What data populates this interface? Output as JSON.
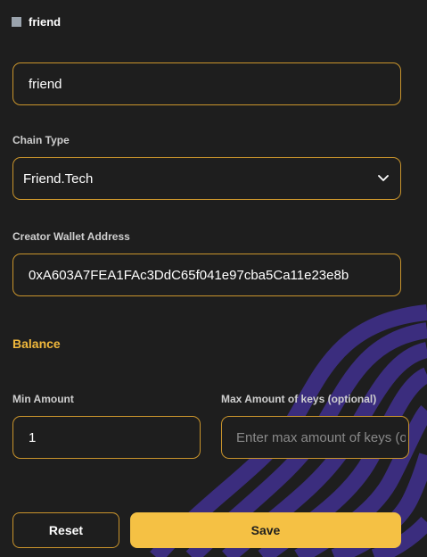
{
  "header": {
    "title": "friend"
  },
  "form": {
    "name_value": "friend",
    "chain_type_label": "Chain Type",
    "chain_type_value": "Friend.Tech",
    "creator_wallet_label": "Creator Wallet Address",
    "creator_wallet_value": "0xA603A7FEA1FAc3DdC65f041e97cba5Ca11e23e8b",
    "balance_title": "Balance",
    "min_amount_label": "Min Amount",
    "min_amount_value": "1",
    "max_amount_label": "Max Amount of keys (optional)",
    "max_amount_placeholder": "Enter max amount of keys (optional)"
  },
  "buttons": {
    "reset_label": "Reset",
    "save_label": "Save"
  },
  "colors": {
    "background": "#1e1e1e",
    "border_accent": "#c9942c",
    "balance_accent": "#f0b83c",
    "save_button": "#f5c144",
    "decor_purple": "#3b2d7e"
  },
  "icons": {
    "chain_dropdown": "chevron-down-icon",
    "header_marker": "square-icon"
  }
}
